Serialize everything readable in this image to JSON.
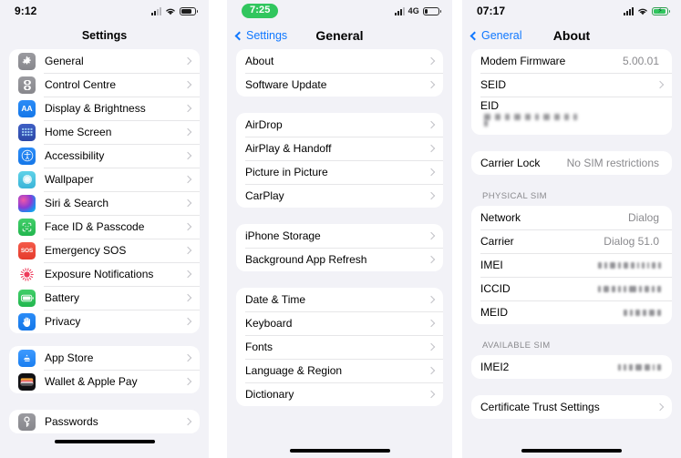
{
  "panels": [
    {
      "id": "settings",
      "status": {
        "time": "9:12",
        "time_style": "plain",
        "network_label": "",
        "battery_level": 75,
        "wifi": true
      },
      "nav": {
        "back_label": "",
        "title": "Settings"
      },
      "groups": [
        {
          "rows": [
            {
              "label": "General",
              "icon": "gear-icon",
              "icon_class": "ico-general",
              "chevron": true
            },
            {
              "label": "Control Centre",
              "icon": "control-centre-icon",
              "icon_class": "ico-control",
              "chevron": true
            },
            {
              "label": "Display & Brightness",
              "icon": "display-brightness-icon",
              "icon_class": "ico-display",
              "chevron": true
            },
            {
              "label": "Home Screen",
              "icon": "home-screen-icon",
              "icon_class": "ico-home",
              "chevron": true
            },
            {
              "label": "Accessibility",
              "icon": "accessibility-icon",
              "icon_class": "ico-access",
              "chevron": true
            },
            {
              "label": "Wallpaper",
              "icon": "wallpaper-icon",
              "icon_class": "ico-wall",
              "chevron": true
            },
            {
              "label": "Siri & Search",
              "icon": "siri-icon",
              "icon_class": "ico-siri",
              "chevron": true
            },
            {
              "label": "Face ID & Passcode",
              "icon": "face-id-icon",
              "icon_class": "ico-faceid",
              "chevron": true
            },
            {
              "label": "Emergency SOS",
              "icon": "emergency-sos-icon",
              "icon_class": "ico-sos",
              "chevron": true
            },
            {
              "label": "Exposure Notifications",
              "icon": "exposure-notifications-icon",
              "icon_class": "ico-exposure",
              "chevron": true
            },
            {
              "label": "Battery",
              "icon": "battery-icon",
              "icon_class": "ico-battery",
              "chevron": true
            },
            {
              "label": "Privacy",
              "icon": "privacy-hand-icon",
              "icon_class": "ico-privacy",
              "chevron": true
            }
          ]
        },
        {
          "rows": [
            {
              "label": "App Store",
              "icon": "app-store-icon",
              "icon_class": "ico-appstore",
              "chevron": true
            },
            {
              "label": "Wallet & Apple Pay",
              "icon": "wallet-icon",
              "icon_class": "ico-wallet",
              "chevron": true
            }
          ]
        },
        {
          "rows": [
            {
              "label": "Passwords",
              "icon": "passwords-key-icon",
              "icon_class": "ico-passwords",
              "chevron": true
            }
          ]
        }
      ]
    },
    {
      "id": "general",
      "status": {
        "time": "7:25",
        "time_style": "pill",
        "network_label": "4G",
        "battery_level": 22,
        "wifi": false
      },
      "nav": {
        "back_label": "Settings",
        "title": "General"
      },
      "groups": [
        {
          "rows": [
            {
              "label": "About",
              "chevron": true
            },
            {
              "label": "Software Update",
              "chevron": true
            }
          ]
        },
        {
          "rows": [
            {
              "label": "AirDrop",
              "chevron": true
            },
            {
              "label": "AirPlay & Handoff",
              "chevron": true
            },
            {
              "label": "Picture in Picture",
              "chevron": true
            },
            {
              "label": "CarPlay",
              "chevron": true
            }
          ]
        },
        {
          "rows": [
            {
              "label": "iPhone Storage",
              "chevron": true
            },
            {
              "label": "Background App Refresh",
              "chevron": true
            }
          ]
        },
        {
          "rows": [
            {
              "label": "Date & Time",
              "chevron": true
            },
            {
              "label": "Keyboard",
              "chevron": true
            },
            {
              "label": "Fonts",
              "chevron": true
            },
            {
              "label": "Language & Region",
              "chevron": true
            },
            {
              "label": "Dictionary",
              "chevron": true
            }
          ]
        }
      ]
    },
    {
      "id": "about",
      "status": {
        "time": "07:17",
        "time_style": "plain",
        "network_label": "",
        "battery_level": 90,
        "wifi": true,
        "charging": true
      },
      "nav": {
        "back_label": "General",
        "title": "About"
      },
      "groups": [
        {
          "rows": [
            {
              "label": "Modem Firmware",
              "value": "5.00.01"
            },
            {
              "label": "SEID",
              "chevron": true
            },
            {
              "label": "EID",
              "redacted_block": true
            }
          ]
        },
        {
          "rows": [
            {
              "label": "Carrier Lock",
              "value": "No SIM restrictions"
            }
          ]
        },
        {
          "header": "PHYSICAL SIM",
          "rows": [
            {
              "label": "Network",
              "value": "Dialog"
            },
            {
              "label": "Carrier",
              "value": "Dialog 51.0"
            },
            {
              "label": "IMEI",
              "redacted": true
            },
            {
              "label": "ICCID",
              "redacted": true
            },
            {
              "label": "MEID",
              "redacted": true
            }
          ]
        },
        {
          "header": "AVAILABLE SIM",
          "rows": [
            {
              "label": "IMEI2",
              "redacted": true
            }
          ]
        },
        {
          "rows": [
            {
              "label": "Certificate Trust Settings",
              "chevron": true
            }
          ]
        }
      ]
    }
  ],
  "colors": {
    "accent_blue": "#1078ff",
    "background": "#f2f2f7",
    "card": "#ffffff",
    "secondary_text": "#8a8a8e",
    "green_pill": "#31c65e"
  }
}
